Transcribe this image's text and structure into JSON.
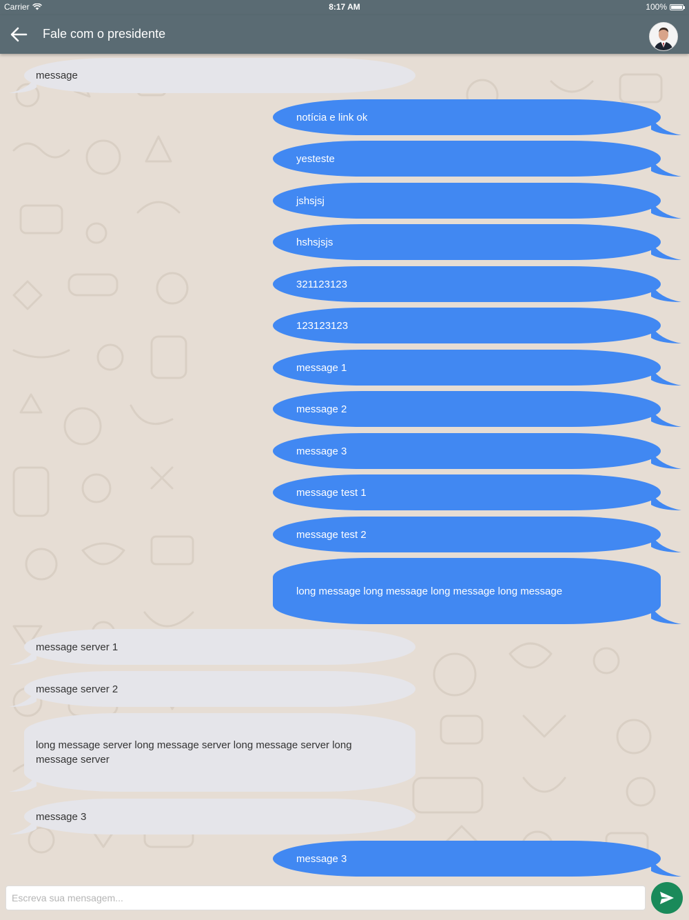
{
  "status_bar": {
    "carrier": "Carrier",
    "time": "8:17 AM",
    "battery": "100%"
  },
  "header": {
    "title": "Fale com o presidente",
    "back_icon": "arrow-left-icon",
    "avatar": "president-avatar"
  },
  "messages": [
    {
      "dir": "in",
      "text": "message"
    },
    {
      "dir": "out",
      "text": "notícia e link ok"
    },
    {
      "dir": "out",
      "text": "yesteste"
    },
    {
      "dir": "out",
      "text": "jshsjsj"
    },
    {
      "dir": "out",
      "text": "hshsjsjs"
    },
    {
      "dir": "out",
      "text": "321123123"
    },
    {
      "dir": "out",
      "text": "123123123"
    },
    {
      "dir": "out",
      "text": "message 1"
    },
    {
      "dir": "out",
      "text": "message 2"
    },
    {
      "dir": "out",
      "text": "message 3"
    },
    {
      "dir": "out",
      "text": "message test 1"
    },
    {
      "dir": "out",
      "text": "message test 2"
    },
    {
      "dir": "out",
      "text": "long message long message long message long message"
    },
    {
      "dir": "in",
      "text": "message server 1"
    },
    {
      "dir": "in",
      "text": "message server 2"
    },
    {
      "dir": "in",
      "text": "long message server long message server long message server long message server"
    },
    {
      "dir": "in",
      "text": "message 3"
    },
    {
      "dir": "out",
      "text": "message 3"
    }
  ],
  "composer": {
    "placeholder": "Escreva sua mensagem...",
    "value": "",
    "send_icon": "send-icon"
  },
  "colors": {
    "header": "#5a6b73",
    "outgoing": "#4188f2",
    "incoming": "#e5e5ea",
    "send": "#1a8a5a",
    "background": "#e6ddd4"
  }
}
